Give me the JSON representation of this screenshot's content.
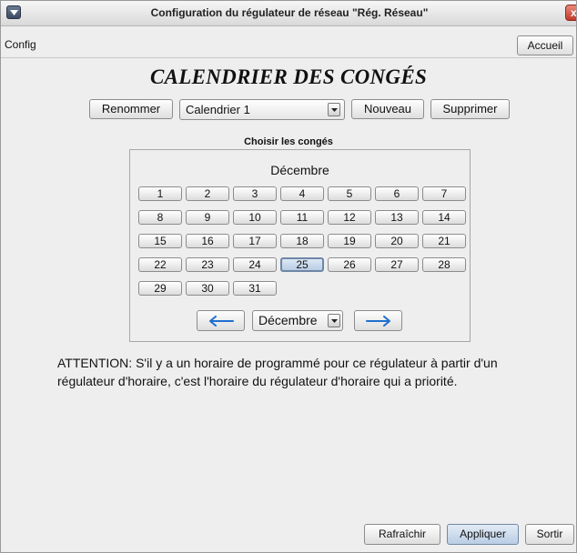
{
  "window": {
    "title": "Configuration du régulateur de réseau \"Rég. Réseau\"",
    "close_label": "x"
  },
  "menubar": {
    "config_label": "Config",
    "home_button": "Accueil"
  },
  "heading": "CALENDRIER DES CONGÉS",
  "toolbar": {
    "rename_button": "Renommer",
    "calendar_selected": "Calendrier 1",
    "new_button": "Nouveau",
    "delete_button": "Supprimer"
  },
  "holiday_picker": {
    "section_title": "Choisir les congés",
    "month_label": "Décembre",
    "days": [
      "1",
      "2",
      "3",
      "4",
      "5",
      "6",
      "7",
      "8",
      "9",
      "10",
      "11",
      "12",
      "13",
      "14",
      "15",
      "16",
      "17",
      "18",
      "19",
      "20",
      "21",
      "22",
      "23",
      "24",
      "25",
      "26",
      "27",
      "28",
      "29",
      "30",
      "31"
    ],
    "selected_day": "25",
    "month_select_value": "Décembre"
  },
  "notice": "ATTENTION: S'il y a un horaire de programmé pour ce régulateur à partir d'un régulateur d'horaire, c'est l'horaire du régulateur d'horaire qui a priorité.",
  "footer": {
    "refresh_button": "Rafraîchir",
    "apply_button": "Appliquer",
    "exit_button": "Sortir"
  }
}
